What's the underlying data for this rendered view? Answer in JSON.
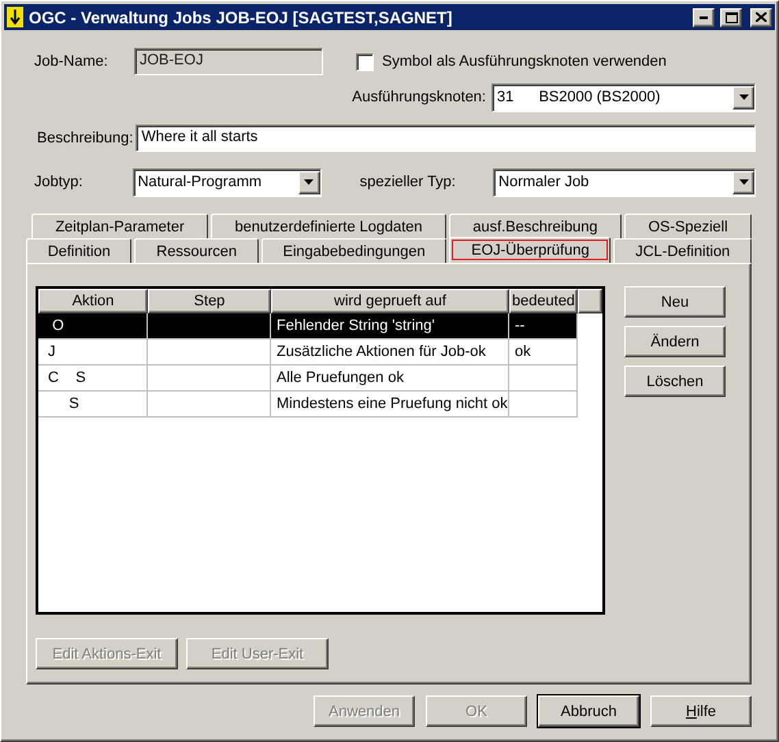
{
  "window": {
    "title": "OGC - Verwaltung Jobs JOB-EOJ [SAGTEST,SAGNET]"
  },
  "job_name": {
    "label": "Job-Name:",
    "value": "JOB-EOJ"
  },
  "symbol_checkbox": {
    "label": "Symbol als Ausführungsknoten verwenden",
    "checked": false
  },
  "node": {
    "label": "Ausführungsknoten:",
    "value": "31      BS2000 (BS2000)"
  },
  "description": {
    "label": "Beschreibung:",
    "value": "Where it all starts"
  },
  "job_type": {
    "label": "Jobtyp:",
    "value": "Natural-Programm"
  },
  "special_type": {
    "label": "spezieller Typ:",
    "value": "Normaler Job"
  },
  "tab_rows": [
    [
      {
        "label": "Zeitplan-Parameter",
        "selected": false
      },
      {
        "label": "benutzerdefinierte Logdaten",
        "selected": false
      },
      {
        "label": "ausf.Beschreibung",
        "selected": false
      },
      {
        "label": "OS-Speziell",
        "selected": false
      }
    ],
    [
      {
        "label": "Definition",
        "selected": false
      },
      {
        "label": "Ressourcen",
        "selected": false
      },
      {
        "label": "Eingabebedingungen",
        "selected": false
      },
      {
        "label": "EOJ-Überprüfung",
        "selected": true
      },
      {
        "label": "JCL-Definition",
        "selected": false
      }
    ]
  ],
  "table": {
    "columns": [
      "Aktion",
      "Step",
      "wird geprueft auf",
      "bedeuted"
    ],
    "rows": [
      {
        "cells": [
          "  O",
          "",
          "Fehlender String 'string'",
          "--"
        ],
        "selected": true
      },
      {
        "cells": [
          " J",
          "",
          "Zusätzliche Aktionen für Job-ok",
          "ok"
        ],
        "selected": false
      },
      {
        "cells": [
          " C    S",
          "",
          "Alle Pruefungen ok",
          ""
        ],
        "selected": false
      },
      {
        "cells": [
          "      S",
          "",
          "Mindestens eine Pruefung nicht ok",
          ""
        ],
        "selected": false
      }
    ]
  },
  "side_buttons": [
    {
      "label": "Neu",
      "disabled": false
    },
    {
      "label": "Ändern",
      "disabled": false
    },
    {
      "label": "Löschen",
      "disabled": false
    }
  ],
  "exit_buttons": [
    {
      "label": "Edit Aktions-Exit",
      "disabled": true
    },
    {
      "label": "Edit User-Exit",
      "disabled": true
    }
  ],
  "dialog_buttons": [
    {
      "label": "Anwenden",
      "disabled": true,
      "default": false,
      "mnemonic": false
    },
    {
      "label": "OK",
      "disabled": true,
      "default": false,
      "mnemonic": false
    },
    {
      "label": "Abbruch",
      "disabled": false,
      "default": true,
      "mnemonic": false
    },
    {
      "label": "Hilfe",
      "disabled": false,
      "default": false,
      "mnemonic": true
    }
  ]
}
